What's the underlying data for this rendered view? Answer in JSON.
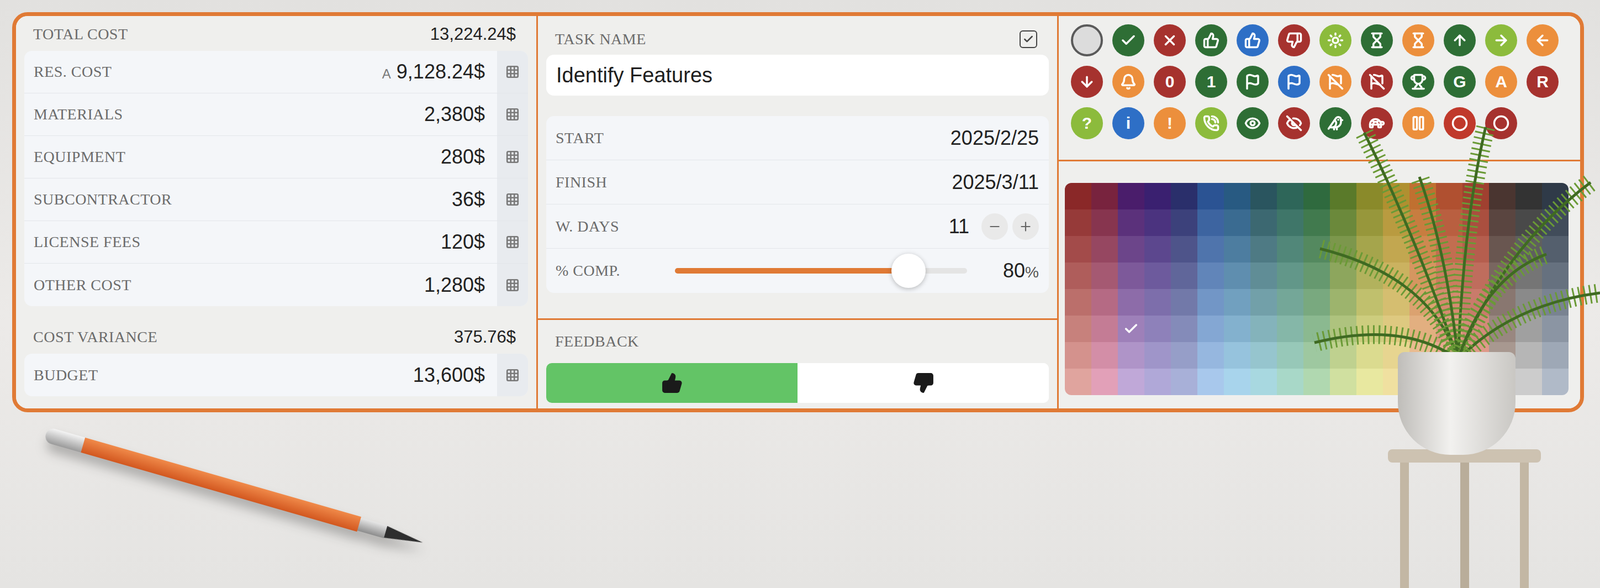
{
  "cost": {
    "total": {
      "label": "TOTAL COST",
      "value": "13,224.24$"
    },
    "items": [
      {
        "label": "RES. COST",
        "value": "9,128.24$",
        "badge": "A"
      },
      {
        "label": "MATERIALS",
        "value": "2,380$"
      },
      {
        "label": "EQUIPMENT",
        "value": "280$"
      },
      {
        "label": "SUBCONTRACTOR",
        "value": "36$"
      },
      {
        "label": "LICENSE FEES",
        "value": "120$"
      },
      {
        "label": "OTHER COST",
        "value": "1,280$"
      }
    ],
    "variance": {
      "label": "COST VARIANCE",
      "value": "375.76$"
    },
    "budget": {
      "label": "BUDGET",
      "value": "13,600$"
    }
  },
  "task": {
    "header": "TASK NAME",
    "checked": true,
    "name": "Identify Features"
  },
  "schedule": [
    {
      "kind": "text",
      "label": "START",
      "value": "2025/2/25"
    },
    {
      "kind": "text",
      "label": "FINISH",
      "value": "2025/3/11"
    },
    {
      "kind": "stepper",
      "label": "W. DAYS",
      "value": "11"
    },
    {
      "kind": "slider",
      "label": "% COMP.",
      "level": 0.8,
      "reading": "80",
      "unit": "%"
    }
  ],
  "feedback": {
    "header": "FEEDBACK",
    "options": [
      {
        "kind": "thumbs-up",
        "selected": true
      },
      {
        "kind": "thumbs-down",
        "selected": false
      }
    ]
  },
  "icons": [
    {
      "kind": "empty",
      "color": "#dcdcdc",
      "selected": true
    },
    {
      "kind": "check",
      "color": "#2e6e35",
      "selected": false
    },
    {
      "kind": "x",
      "color": "#a6322e",
      "selected": false
    },
    {
      "kind": "thumbs-up",
      "color": "#2e6e35",
      "selected": false
    },
    {
      "kind": "thumbs-up",
      "color": "#2e6fc6",
      "selected": false
    },
    {
      "kind": "thumbs-down",
      "color": "#a6322e",
      "selected": false
    },
    {
      "kind": "sun",
      "color": "#8cbb3c",
      "selected": false
    },
    {
      "kind": "hourglass",
      "color": "#2e6e35",
      "selected": false
    },
    {
      "kind": "hourglass",
      "color": "#ec8f3c",
      "selected": false
    },
    {
      "kind": "arrow-up",
      "color": "#2e6e35",
      "selected": false
    },
    {
      "kind": "arrow-right",
      "color": "#8cbb3c",
      "selected": false
    },
    {
      "kind": "arrow-left",
      "color": "#ec8f3c",
      "selected": false
    },
    {
      "kind": "arrow-down",
      "color": "#a6322e",
      "selected": false
    },
    {
      "kind": "bell",
      "color": "#ec8f3c",
      "selected": false
    },
    {
      "kind": "letter",
      "label": "0",
      "color": "#a6322e",
      "selected": false
    },
    {
      "kind": "letter",
      "label": "1",
      "color": "#2e6e35",
      "selected": false
    },
    {
      "kind": "flag",
      "color": "#2e6e35",
      "selected": false
    },
    {
      "kind": "flag",
      "color": "#2e6fc6",
      "selected": false
    },
    {
      "kind": "flag-off",
      "color": "#ec8f3c",
      "selected": false
    },
    {
      "kind": "flag-off",
      "color": "#a6322e",
      "selected": false
    },
    {
      "kind": "trophy",
      "color": "#2e6e35",
      "selected": false
    },
    {
      "kind": "letter",
      "label": "G",
      "color": "#2e6e35",
      "selected": false
    },
    {
      "kind": "letter",
      "label": "A",
      "color": "#ec8f3c",
      "selected": false
    },
    {
      "kind": "letter",
      "label": "R",
      "color": "#a6322e",
      "selected": false
    },
    {
      "kind": "letter",
      "label": "?",
      "color": "#8cbb3c",
      "selected": false
    },
    {
      "kind": "letter",
      "label": "i",
      "color": "#2e6fc6",
      "selected": false
    },
    {
      "kind": "letter",
      "label": "!",
      "color": "#ec8f3c",
      "selected": false
    },
    {
      "kind": "phone",
      "color": "#8cbb3c",
      "selected": false
    },
    {
      "kind": "eye",
      "color": "#2e6e35",
      "selected": false
    },
    {
      "kind": "eye-off",
      "color": "#a6322e",
      "selected": false
    },
    {
      "kind": "bird",
      "color": "#2e6e35",
      "selected": false
    },
    {
      "kind": "turtle",
      "color": "#a6322e",
      "selected": false
    },
    {
      "kind": "pause",
      "color": "#ec8f3c",
      "selected": false
    },
    {
      "kind": "circle",
      "color": "#c0392b",
      "selected": false
    },
    {
      "kind": "circle",
      "color": "#a6322e",
      "selected": false
    }
  ],
  "color_grid": {
    "columns": [
      {
        "cells": [
          {
            "color": "#8a2828",
            "selected": false
          },
          {
            "color": "#963a39",
            "selected": false
          },
          {
            "color": "#a34b4a",
            "selected": false
          },
          {
            "color": "#af5d5b",
            "selected": false
          },
          {
            "color": "#bb6f6b",
            "selected": false
          },
          {
            "color": "#c7817c",
            "selected": false
          },
          {
            "color": "#d4928d",
            "selected": false
          },
          {
            "color": "#e0a49e",
            "selected": false
          }
        ]
      },
      {
        "cells": [
          {
            "color": "#78233e",
            "selected": false
          },
          {
            "color": "#87354f",
            "selected": false
          },
          {
            "color": "#964761",
            "selected": false
          },
          {
            "color": "#a55972",
            "selected": false
          },
          {
            "color": "#b56a84",
            "selected": false
          },
          {
            "color": "#c47c95",
            "selected": false
          },
          {
            "color": "#d38ea7",
            "selected": false
          },
          {
            "color": "#e2a0b8",
            "selected": false
          }
        ]
      },
      {
        "cells": [
          {
            "color": "#4a1d6b",
            "selected": false
          },
          {
            "color": "#5b317b",
            "selected": false
          },
          {
            "color": "#6c458a",
            "selected": false
          },
          {
            "color": "#7d599a",
            "selected": false
          },
          {
            "color": "#8d6ca9",
            "selected": false
          },
          {
            "color": "#9e80b9",
            "selected": true
          },
          {
            "color": "#af94c8",
            "selected": false
          },
          {
            "color": "#c0a8d8",
            "selected": false
          }
        ]
      },
      {
        "cells": [
          {
            "color": "#3a2070",
            "selected": false
          },
          {
            "color": "#4b337f",
            "selected": false
          },
          {
            "color": "#5c478e",
            "selected": false
          },
          {
            "color": "#6d5a9d",
            "selected": false
          },
          {
            "color": "#7d6eab",
            "selected": false
          },
          {
            "color": "#8e81ba",
            "selected": false
          },
          {
            "color": "#9f95c9",
            "selected": false
          },
          {
            "color": "#b0a8d8",
            "selected": false
          }
        ]
      },
      {
        "cells": [
          {
            "color": "#2a2f6b",
            "selected": false
          },
          {
            "color": "#3c417b",
            "selected": false
          },
          {
            "color": "#4e548a",
            "selected": false
          },
          {
            "color": "#60669a",
            "selected": false
          },
          {
            "color": "#7279a9",
            "selected": false
          },
          {
            "color": "#848bb9",
            "selected": false
          },
          {
            "color": "#969ec8",
            "selected": false
          },
          {
            "color": "#a8b0d8",
            "selected": false
          }
        ]
      },
      {
        "cells": [
          {
            "color": "#2b5393",
            "selected": false
          },
          {
            "color": "#3d64a0",
            "selected": false
          },
          {
            "color": "#4f74ac",
            "selected": false
          },
          {
            "color": "#6185b9",
            "selected": false
          },
          {
            "color": "#7296c6",
            "selected": false
          },
          {
            "color": "#84a7d3",
            "selected": false
          },
          {
            "color": "#96b7df",
            "selected": false
          },
          {
            "color": "#a8c8ec",
            "selected": false
          }
        ]
      },
      {
        "cells": [
          {
            "color": "#285a82",
            "selected": false
          },
          {
            "color": "#3a6b91",
            "selected": false
          },
          {
            "color": "#4d7da0",
            "selected": false
          },
          {
            "color": "#5f8eaf",
            "selected": false
          },
          {
            "color": "#71a0bf",
            "selected": false
          },
          {
            "color": "#83b1ce",
            "selected": false
          },
          {
            "color": "#96c3dd",
            "selected": false
          },
          {
            "color": "#a8d4ec",
            "selected": false
          }
        ]
      },
      {
        "cells": [
          {
            "color": "#2a555f",
            "selected": false
          },
          {
            "color": "#3c6871",
            "selected": false
          },
          {
            "color": "#4e7a84",
            "selected": false
          },
          {
            "color": "#608d96",
            "selected": false
          },
          {
            "color": "#72a0a9",
            "selected": false
          },
          {
            "color": "#84b3bb",
            "selected": false
          },
          {
            "color": "#96c5ce",
            "selected": false
          },
          {
            "color": "#a8d8e0",
            "selected": false
          }
        ]
      },
      {
        "cells": [
          {
            "color": "#2e6659",
            "selected": false
          },
          {
            "color": "#3f7669",
            "selected": false
          },
          {
            "color": "#518779",
            "selected": false
          },
          {
            "color": "#629789",
            "selected": false
          },
          {
            "color": "#74a798",
            "selected": false
          },
          {
            "color": "#85b7a8",
            "selected": false
          },
          {
            "color": "#97c8b8",
            "selected": false
          },
          {
            "color": "#a8d8c8",
            "selected": false
          }
        ]
      },
      {
        "cells": [
          {
            "color": "#2f6a3e",
            "selected": false
          },
          {
            "color": "#417a4e",
            "selected": false
          },
          {
            "color": "#54895f",
            "selected": false
          },
          {
            "color": "#66996f",
            "selected": false
          },
          {
            "color": "#79a97f",
            "selected": false
          },
          {
            "color": "#8bb990",
            "selected": false
          },
          {
            "color": "#9ec8a0",
            "selected": false
          },
          {
            "color": "#b0d8b0",
            "selected": false
          }
        ]
      },
      {
        "cells": [
          {
            "color": "#5a7a2a",
            "selected": false
          },
          {
            "color": "#6b893b",
            "selected": false
          },
          {
            "color": "#7c974c",
            "selected": false
          },
          {
            "color": "#8da65d",
            "selected": false
          },
          {
            "color": "#9db46d",
            "selected": false
          },
          {
            "color": "#aec37e",
            "selected": false
          },
          {
            "color": "#bfd18f",
            "selected": false
          },
          {
            "color": "#d0e0a0",
            "selected": false
          }
        ]
      },
      {
        "cells": [
          {
            "color": "#8a8a2a",
            "selected": false
          },
          {
            "color": "#97973b",
            "selected": false
          },
          {
            "color": "#a5a54c",
            "selected": false
          },
          {
            "color": "#b2b25d",
            "selected": false
          },
          {
            "color": "#c0c06d",
            "selected": false
          },
          {
            "color": "#cdcd7e",
            "selected": false
          },
          {
            "color": "#dbdb8f",
            "selected": false
          },
          {
            "color": "#e8e8a0",
            "selected": false
          }
        ]
      },
      {
        "cells": [
          {
            "color": "#b09030",
            "selected": false
          },
          {
            "color": "#b99b40",
            "selected": false
          },
          {
            "color": "#c2a750",
            "selected": false
          },
          {
            "color": "#cbb260",
            "selected": false
          },
          {
            "color": "#d5be70",
            "selected": false
          },
          {
            "color": "#dec980",
            "selected": false
          },
          {
            "color": "#e7d590",
            "selected": false
          },
          {
            "color": "#f0e0a0",
            "selected": false
          }
        ]
      },
      {
        "cells": [
          {
            "color": "#c07030",
            "selected": false
          },
          {
            "color": "#c77d40",
            "selected": false
          },
          {
            "color": "#ce8950",
            "selected": false
          },
          {
            "color": "#d59660",
            "selected": false
          },
          {
            "color": "#dba270",
            "selected": false
          },
          {
            "color": "#e2af80",
            "selected": false
          },
          {
            "color": "#e9bb90",
            "selected": false
          },
          {
            "color": "#f0c8a0",
            "selected": false
          }
        ]
      },
      {
        "cells": [
          {
            "color": "#b05030",
            "selected": false
          },
          {
            "color": "#b95f40",
            "selected": false
          },
          {
            "color": "#c26e50",
            "selected": false
          },
          {
            "color": "#cb7d60",
            "selected": false
          },
          {
            "color": "#d58b70",
            "selected": false
          },
          {
            "color": "#de9a80",
            "selected": false
          },
          {
            "color": "#e7a990",
            "selected": false
          },
          {
            "color": "#f0b8a0",
            "selected": false
          }
        ]
      },
      {
        "cells": [
          {
            "color": "#a04030",
            "selected": false
          },
          {
            "color": "#aa4f3f",
            "selected": false
          },
          {
            "color": "#b55e4e",
            "selected": false
          },
          {
            "color": "#bf6d5d",
            "selected": false
          },
          {
            "color": "#c97b6b",
            "selected": false
          },
          {
            "color": "#d38a7a",
            "selected": false
          },
          {
            "color": "#de9989",
            "selected": false
          },
          {
            "color": "#e8a898",
            "selected": false
          }
        ]
      },
      {
        "cells": [
          {
            "color": "#4a3530",
            "selected": false
          },
          {
            "color": "#5a4540",
            "selected": false
          },
          {
            "color": "#695650",
            "selected": false
          },
          {
            "color": "#796660",
            "selected": false
          },
          {
            "color": "#897770",
            "selected": false
          },
          {
            "color": "#998780",
            "selected": false
          },
          {
            "color": "#a89890",
            "selected": false
          },
          {
            "color": "#b8a8a0",
            "selected": false
          }
        ]
      },
      {
        "cells": [
          {
            "color": "#333333",
            "selected": false
          },
          {
            "color": "#494949",
            "selected": false
          },
          {
            "color": "#5f5f5f",
            "selected": false
          },
          {
            "color": "#757575",
            "selected": false
          },
          {
            "color": "#8a8a8a",
            "selected": false
          },
          {
            "color": "#a0a0a0",
            "selected": false
          },
          {
            "color": "#b6b6b6",
            "selected": false
          },
          {
            "color": "#cccccc",
            "selected": false
          }
        ]
      },
      {
        "cells": [
          {
            "color": "#2f3a48",
            "selected": false
          },
          {
            "color": "#414c5a",
            "selected": false
          },
          {
            "color": "#545f6d",
            "selected": false
          },
          {
            "color": "#66717f",
            "selected": false
          },
          {
            "color": "#798391",
            "selected": false
          },
          {
            "color": "#8b95a3",
            "selected": false
          },
          {
            "color": "#9ea8b6",
            "selected": false
          },
          {
            "color": "#b0bac8",
            "selected": false
          }
        ]
      }
    ]
  }
}
